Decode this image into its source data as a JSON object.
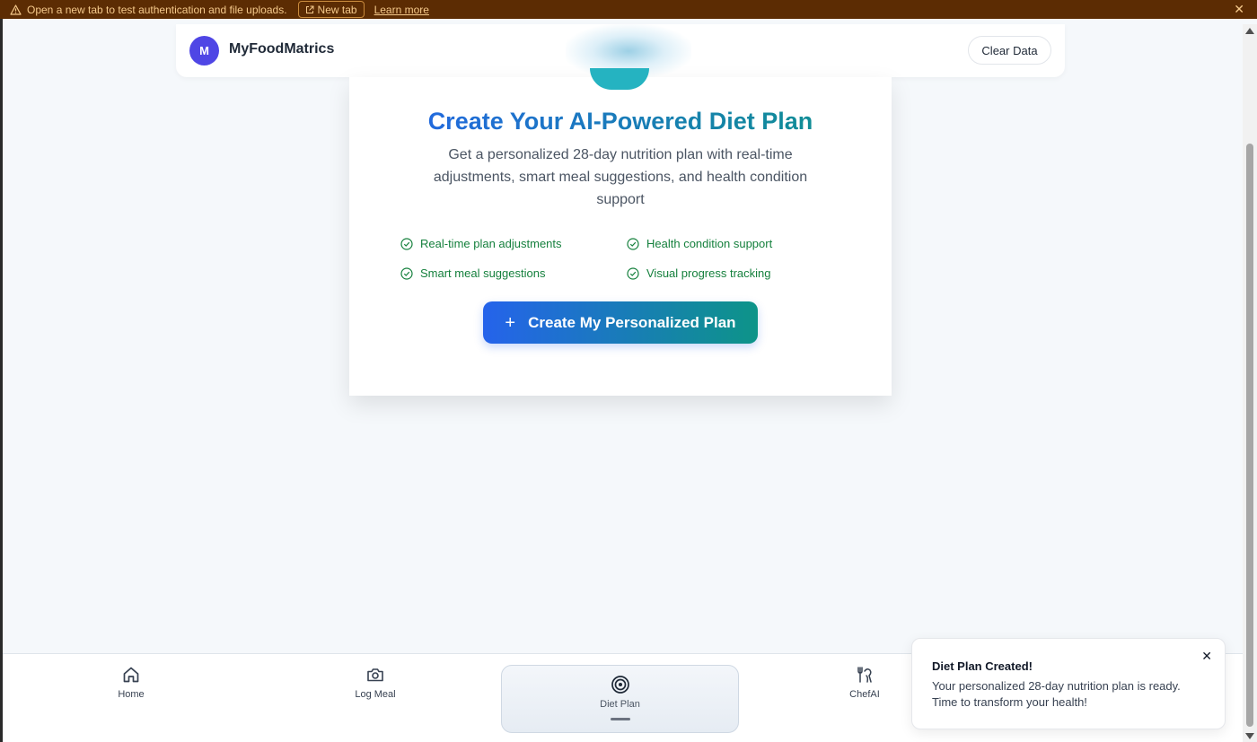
{
  "banner": {
    "message": "Open a new tab to test authentication and file uploads.",
    "new_tab_label": "New tab",
    "learn_more_label": "Learn more",
    "close_label": "✕"
  },
  "header": {
    "avatar_initial": "M",
    "brand": "MyFoodMatrics",
    "clear_button": "Clear Data"
  },
  "hero": {
    "title": "Create Your AI-Powered Diet Plan",
    "subtitle": "Get a personalized 28-day nutrition plan with real-time adjustments, smart meal suggestions, and health condition support",
    "features": [
      "Real-time plan adjustments",
      "Health condition support",
      "Smart meal suggestions",
      "Visual progress tracking"
    ],
    "cta_label": "Create My Personalized Plan",
    "cta_icon": "+"
  },
  "nav": {
    "items": [
      {
        "label": "Home",
        "icon": "home-icon"
      },
      {
        "label": "Log Meal",
        "icon": "camera-icon"
      },
      {
        "label": "Diet Plan",
        "icon": "target-icon",
        "active": true
      },
      {
        "label": "ChefAI",
        "icon": "chef-icon"
      }
    ]
  },
  "toast": {
    "title": "Diet Plan Created!",
    "body": "Your personalized 28-day nutrition plan is ready. Time to transform your health!",
    "close_label": "✕"
  },
  "colors": {
    "banner_bg": "#5c2c03",
    "accent_blue": "#2563eb",
    "accent_teal": "#0d9488",
    "feature_green": "#15803d",
    "avatar": "#4f46e5"
  }
}
